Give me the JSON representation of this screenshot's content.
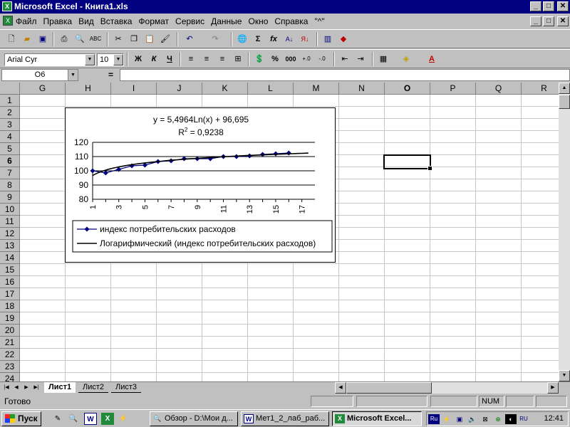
{
  "window": {
    "title": "Microsoft Excel - Книга1.xls",
    "buttons": {
      "minimize": "_",
      "maximize": "□",
      "close": "✕"
    }
  },
  "menubar": {
    "items": [
      "Файл",
      "Правка",
      "Вид",
      "Вставка",
      "Формат",
      "Сервис",
      "Данные",
      "Окно",
      "Справка",
      "\"^\""
    ]
  },
  "toolbar": {
    "font_name": "Arial Cyr",
    "font_size": "10",
    "bold": "Ж",
    "italic": "К",
    "underline": "Ч",
    "sum": "Σ",
    "fx": "fx",
    "percent": "%",
    "thousands": "000"
  },
  "formula": {
    "name_box": "O6",
    "equals": "=",
    "value": ""
  },
  "columns": [
    "G",
    "H",
    "I",
    "J",
    "K",
    "L",
    "M",
    "N",
    "O",
    "P",
    "Q",
    "R"
  ],
  "active_column": "O",
  "rows": [
    "1",
    "2",
    "3",
    "4",
    "5",
    "6",
    "7",
    "8",
    "9",
    "10",
    "11",
    "12",
    "13",
    "14",
    "15",
    "16",
    "17",
    "18",
    "19",
    "20",
    "21",
    "22",
    "23",
    "24"
  ],
  "active_row": "6",
  "chart_data": {
    "type": "line",
    "trendline_equation": "y = 5,4964Ln(x) + 96,695",
    "r_squared_base": "R",
    "r_squared_exp": "2",
    "r_squared_value": " = 0,9238",
    "x": [
      1,
      2,
      3,
      4,
      5,
      6,
      7,
      8,
      9,
      10,
      11,
      12,
      13,
      14,
      15,
      16,
      17
    ],
    "x_tick_labels": [
      "1",
      "3",
      "5",
      "7",
      "9",
      "11",
      "13",
      "15",
      "17"
    ],
    "y_tick_labels": [
      "120",
      "110",
      "100",
      "90",
      "80"
    ],
    "ylim": [
      80,
      120
    ],
    "y_ticks": [
      80,
      90,
      100,
      110,
      120
    ],
    "grid": true,
    "series": [
      {
        "name": "индекс потребительских расходов",
        "values": [
          100,
          98.5,
          101,
          103.5,
          104,
          106.5,
          107,
          108.5,
          108.5,
          108.5,
          110,
          110,
          110.5,
          111.5,
          112,
          112.5,
          null
        ],
        "color": "#000080"
      },
      {
        "name": "Логарифмический (индекс потребительских расходов)",
        "trend": {
          "a": 5.4964,
          "b": 96.695
        },
        "color": "#000000"
      }
    ],
    "legend_position": "bottom"
  },
  "sheets": {
    "tabs": [
      "Лист1",
      "Лист2",
      "Лист3"
    ],
    "active": "Лист1"
  },
  "status": {
    "text": "Готово",
    "num": "NUM"
  },
  "taskbar": {
    "start": "Пуск",
    "tasks": [
      {
        "label": "Обзор - D:\\Мои д..."
      },
      {
        "label": "Мет1_2_лаб_раб..."
      },
      {
        "label": "Microsoft Excel..."
      }
    ],
    "tray_lang": "Ru",
    "tray_lang2": "RU",
    "clock": "12:41"
  }
}
